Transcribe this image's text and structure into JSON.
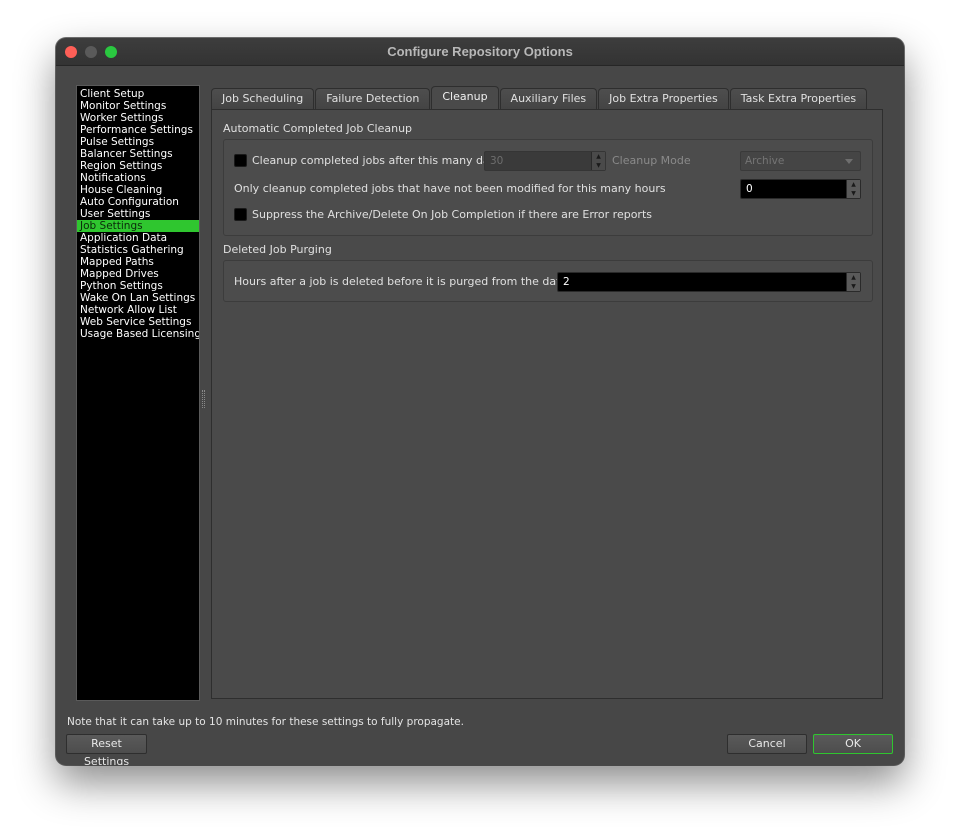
{
  "window": {
    "title": "Configure Repository Options"
  },
  "sidebar": {
    "items": [
      "Client Setup",
      "Monitor Settings",
      "Worker Settings",
      "Performance Settings",
      "Pulse Settings",
      "Balancer Settings",
      "Region Settings",
      "Notifications",
      "House Cleaning",
      "Auto Configuration",
      "User Settings",
      "Job Settings",
      "Application Data",
      "Statistics Gathering",
      "Mapped Paths",
      "Mapped Drives",
      "Python Settings",
      "Wake On Lan Settings",
      "Network Allow List",
      "Web Service Settings",
      "Usage Based Licensing"
    ],
    "selected": "Job Settings",
    "selected_color": "#2fc62f"
  },
  "tabs": [
    "Job Scheduling",
    "Failure Detection",
    "Cleanup",
    "Auxiliary Files",
    "Job Extra Properties",
    "Task Extra Properties"
  ],
  "active_tab": "Cleanup",
  "cleanup": {
    "section_title": "Automatic Completed Job Cleanup",
    "cleanup_days": {
      "label": "Cleanup completed jobs after this many days",
      "checked": false,
      "value": "30"
    },
    "cleanup_mode": {
      "label": "Cleanup Mode",
      "value": "Archive"
    },
    "not_modified_hours": {
      "label": "Only cleanup completed jobs that have not been modified for this many hours",
      "value": "0"
    },
    "suppress": {
      "label": "Suppress the Archive/Delete On Job Completion if there are Error reports",
      "checked": false
    }
  },
  "purging": {
    "section_title": "Deleted Job Purging",
    "hours": {
      "label": "Hours after a job is deleted before it is purged from the database",
      "value": "2"
    }
  },
  "footer": {
    "note": "Note that it can take up to 10 minutes for these settings to fully propagate.",
    "reset_label": "Reset Settings",
    "cancel_label": "Cancel",
    "ok_label": "OK"
  }
}
